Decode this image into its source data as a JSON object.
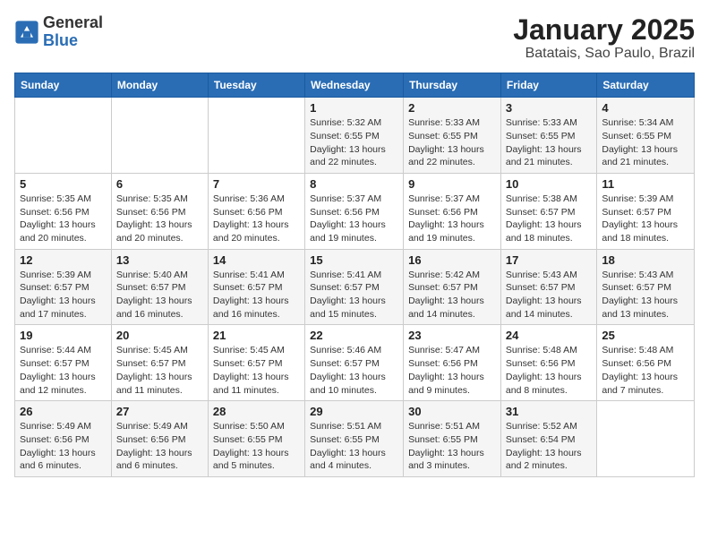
{
  "logo": {
    "general": "General",
    "blue": "Blue"
  },
  "title": "January 2025",
  "subtitle": "Batatais, Sao Paulo, Brazil",
  "days_header": [
    "Sunday",
    "Monday",
    "Tuesday",
    "Wednesday",
    "Thursday",
    "Friday",
    "Saturday"
  ],
  "weeks": [
    [
      {
        "num": "",
        "detail": ""
      },
      {
        "num": "",
        "detail": ""
      },
      {
        "num": "",
        "detail": ""
      },
      {
        "num": "1",
        "detail": "Sunrise: 5:32 AM\nSunset: 6:55 PM\nDaylight: 13 hours\nand 22 minutes."
      },
      {
        "num": "2",
        "detail": "Sunrise: 5:33 AM\nSunset: 6:55 PM\nDaylight: 13 hours\nand 22 minutes."
      },
      {
        "num": "3",
        "detail": "Sunrise: 5:33 AM\nSunset: 6:55 PM\nDaylight: 13 hours\nand 21 minutes."
      },
      {
        "num": "4",
        "detail": "Sunrise: 5:34 AM\nSunset: 6:55 PM\nDaylight: 13 hours\nand 21 minutes."
      }
    ],
    [
      {
        "num": "5",
        "detail": "Sunrise: 5:35 AM\nSunset: 6:56 PM\nDaylight: 13 hours\nand 20 minutes."
      },
      {
        "num": "6",
        "detail": "Sunrise: 5:35 AM\nSunset: 6:56 PM\nDaylight: 13 hours\nand 20 minutes."
      },
      {
        "num": "7",
        "detail": "Sunrise: 5:36 AM\nSunset: 6:56 PM\nDaylight: 13 hours\nand 20 minutes."
      },
      {
        "num": "8",
        "detail": "Sunrise: 5:37 AM\nSunset: 6:56 PM\nDaylight: 13 hours\nand 19 minutes."
      },
      {
        "num": "9",
        "detail": "Sunrise: 5:37 AM\nSunset: 6:56 PM\nDaylight: 13 hours\nand 19 minutes."
      },
      {
        "num": "10",
        "detail": "Sunrise: 5:38 AM\nSunset: 6:57 PM\nDaylight: 13 hours\nand 18 minutes."
      },
      {
        "num": "11",
        "detail": "Sunrise: 5:39 AM\nSunset: 6:57 PM\nDaylight: 13 hours\nand 18 minutes."
      }
    ],
    [
      {
        "num": "12",
        "detail": "Sunrise: 5:39 AM\nSunset: 6:57 PM\nDaylight: 13 hours\nand 17 minutes."
      },
      {
        "num": "13",
        "detail": "Sunrise: 5:40 AM\nSunset: 6:57 PM\nDaylight: 13 hours\nand 16 minutes."
      },
      {
        "num": "14",
        "detail": "Sunrise: 5:41 AM\nSunset: 6:57 PM\nDaylight: 13 hours\nand 16 minutes."
      },
      {
        "num": "15",
        "detail": "Sunrise: 5:41 AM\nSunset: 6:57 PM\nDaylight: 13 hours\nand 15 minutes."
      },
      {
        "num": "16",
        "detail": "Sunrise: 5:42 AM\nSunset: 6:57 PM\nDaylight: 13 hours\nand 14 minutes."
      },
      {
        "num": "17",
        "detail": "Sunrise: 5:43 AM\nSunset: 6:57 PM\nDaylight: 13 hours\nand 14 minutes."
      },
      {
        "num": "18",
        "detail": "Sunrise: 5:43 AM\nSunset: 6:57 PM\nDaylight: 13 hours\nand 13 minutes."
      }
    ],
    [
      {
        "num": "19",
        "detail": "Sunrise: 5:44 AM\nSunset: 6:57 PM\nDaylight: 13 hours\nand 12 minutes."
      },
      {
        "num": "20",
        "detail": "Sunrise: 5:45 AM\nSunset: 6:57 PM\nDaylight: 13 hours\nand 11 minutes."
      },
      {
        "num": "21",
        "detail": "Sunrise: 5:45 AM\nSunset: 6:57 PM\nDaylight: 13 hours\nand 11 minutes."
      },
      {
        "num": "22",
        "detail": "Sunrise: 5:46 AM\nSunset: 6:57 PM\nDaylight: 13 hours\nand 10 minutes."
      },
      {
        "num": "23",
        "detail": "Sunrise: 5:47 AM\nSunset: 6:56 PM\nDaylight: 13 hours\nand 9 minutes."
      },
      {
        "num": "24",
        "detail": "Sunrise: 5:48 AM\nSunset: 6:56 PM\nDaylight: 13 hours\nand 8 minutes."
      },
      {
        "num": "25",
        "detail": "Sunrise: 5:48 AM\nSunset: 6:56 PM\nDaylight: 13 hours\nand 7 minutes."
      }
    ],
    [
      {
        "num": "26",
        "detail": "Sunrise: 5:49 AM\nSunset: 6:56 PM\nDaylight: 13 hours\nand 6 minutes."
      },
      {
        "num": "27",
        "detail": "Sunrise: 5:49 AM\nSunset: 6:56 PM\nDaylight: 13 hours\nand 6 minutes."
      },
      {
        "num": "28",
        "detail": "Sunrise: 5:50 AM\nSunset: 6:55 PM\nDaylight: 13 hours\nand 5 minutes."
      },
      {
        "num": "29",
        "detail": "Sunrise: 5:51 AM\nSunset: 6:55 PM\nDaylight: 13 hours\nand 4 minutes."
      },
      {
        "num": "30",
        "detail": "Sunrise: 5:51 AM\nSunset: 6:55 PM\nDaylight: 13 hours\nand 3 minutes."
      },
      {
        "num": "31",
        "detail": "Sunrise: 5:52 AM\nSunset: 6:54 PM\nDaylight: 13 hours\nand 2 minutes."
      },
      {
        "num": "",
        "detail": ""
      }
    ]
  ]
}
